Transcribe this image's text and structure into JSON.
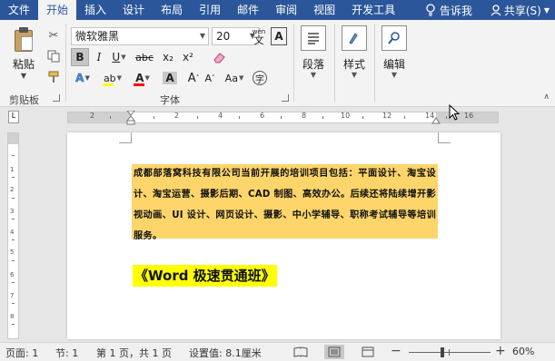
{
  "tabs": [
    "文件",
    "开始",
    "插入",
    "设计",
    "布局",
    "引用",
    "邮件",
    "审阅",
    "视图",
    "开发工具"
  ],
  "active_tab_index": 1,
  "tell_me": "告诉我",
  "share": "共享(S)",
  "clipboard": {
    "paste_label": "粘贴",
    "group_label": "剪贴板"
  },
  "font": {
    "family": "微软雅黑",
    "size": "20",
    "group_label": "字体",
    "wen_label": "wén",
    "wen_char": "文",
    "bold": "B",
    "italic": "I",
    "underline": "U",
    "strike": "abc",
    "subscript": "x₂",
    "superscript": "x²",
    "grow": "A",
    "shrink": "A",
    "case": "Aa",
    "phonetic": "字",
    "highlight_color": "#ffff00",
    "font_color": "#ff0000"
  },
  "paragraph": {
    "label": "段落"
  },
  "styles": {
    "label": "样式"
  },
  "editing": {
    "label": "编辑"
  },
  "ruler": {
    "numbers": [
      "2",
      "2",
      "4",
      "6",
      "8",
      "10",
      "12",
      "14",
      "16"
    ]
  },
  "vruler": {
    "numbers": [
      "1",
      "2",
      "3",
      "4",
      "5",
      "6",
      "7",
      "8"
    ]
  },
  "document": {
    "paragraph": "成都部落窝科技有限公司当前开展的培训项目包括：平面设计、淘宝设计、淘宝运营、摄影后期、CAD 制图、高效办公。后续还将陆续增开影视动画、UI 设计、网页设计、摄影、中小学辅导、职称考试辅导等培训服务。",
    "title": "《Word 极速贯通班》",
    "paragraph_highlight": "#fdd56a",
    "title_highlight": "#ffff00"
  },
  "status": {
    "page": "页面: 1",
    "section": "节: 1",
    "page_of": "第 1 页，共 1 页",
    "setting": "设置值: 8.1厘米",
    "zoom": "60%"
  },
  "colors": {
    "ribbon_blue": "#2b579a"
  }
}
